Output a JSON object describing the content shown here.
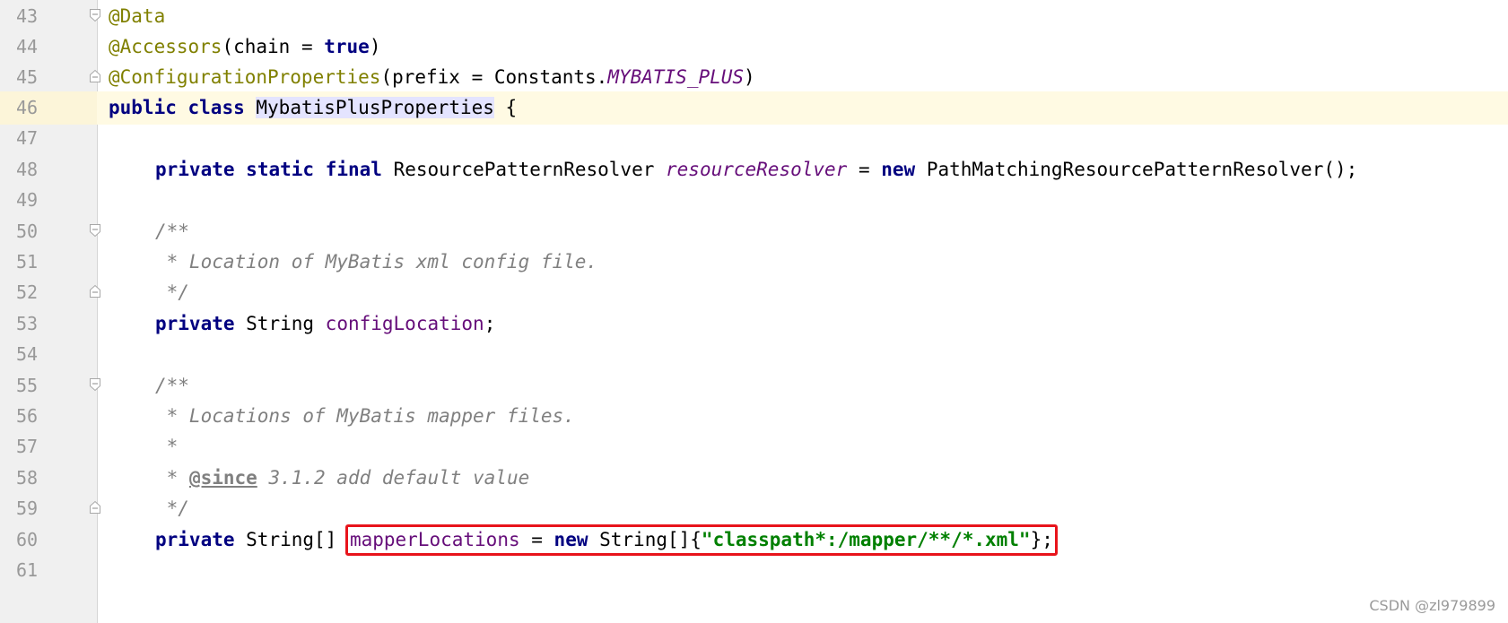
{
  "editor": {
    "lines": {
      "l43": {
        "num": "43",
        "ann": "@Data"
      },
      "l44": {
        "num": "44",
        "ann": "@Accessors",
        "open": "(chain = ",
        "kw": "true",
        "close": ")"
      },
      "l45": {
        "num": "45",
        "ann": "@ConfigurationProperties",
        "open": "(prefix = Constants.",
        "const": "MYBATIS_PLUS",
        "close": ")"
      },
      "l46": {
        "num": "46",
        "kw1": "public",
        "kw2": "class",
        "name": "MybatisPlusProperties",
        "brace": " {"
      },
      "l47": {
        "num": "47"
      },
      "l48": {
        "num": "48",
        "kw1": "private",
        "kw2": "static",
        "kw3": "final",
        "type": "ResourcePatternResolver",
        "field": "resourceResolver",
        "eq": " = ",
        "kw4": "new",
        "rest": " PathMatchingResourcePatternResolver();"
      },
      "l49": {
        "num": "49"
      },
      "l50": {
        "num": "50",
        "cmt": "/**"
      },
      "l51": {
        "num": "51",
        "cmt": " * Location of MyBatis xml config file."
      },
      "l52": {
        "num": "52",
        "cmt": " */"
      },
      "l53": {
        "num": "53",
        "kw1": "private",
        "type": " String ",
        "field": "configLocation",
        "end": ";"
      },
      "l54": {
        "num": "54"
      },
      "l55": {
        "num": "55",
        "cmt": "/**"
      },
      "l56": {
        "num": "56",
        "cmt": " * Locations of MyBatis mapper files."
      },
      "l57": {
        "num": "57",
        "cmt": " *"
      },
      "l58": {
        "num": "58",
        "cmt_pre": " * ",
        "tag": "@since",
        "cmt_post": " 3.1.2 add default value"
      },
      "l59": {
        "num": "59",
        "cmt": " */"
      },
      "l60": {
        "num": "60",
        "kw1": "private",
        "type": " String[] ",
        "field": "mapperLocations",
        "eq": " = ",
        "kw2": "new",
        "type2": " String[]{",
        "str": "\"classpath*:/mapper/**/*.xml\"",
        "end": "};"
      },
      "l61": {
        "num": "61"
      }
    }
  },
  "watermark": "CSDN @zl979899",
  "colors": {
    "annotation": "#808000",
    "keyword": "#000080",
    "field": "#660e7a",
    "comment": "#808080",
    "string": "#008000",
    "highlight_box": "#e8141b",
    "current_line": "#fffae3"
  },
  "icons": {
    "fold_open": "fold-open-icon",
    "fold_close": "fold-close-icon"
  }
}
